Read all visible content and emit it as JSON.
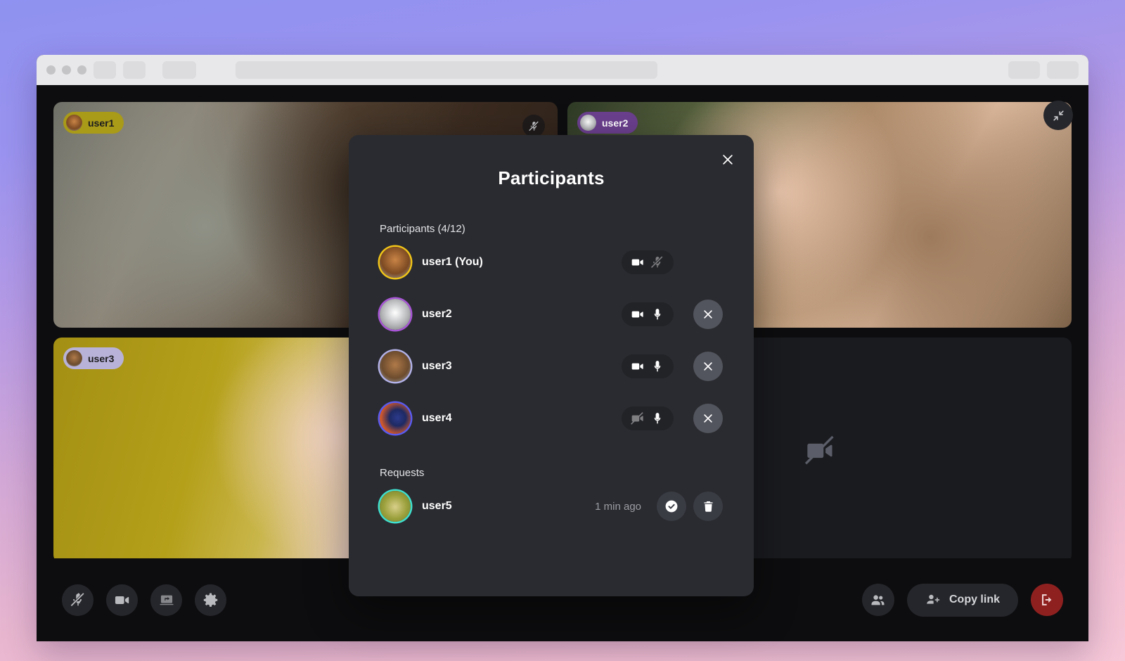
{
  "theme": {
    "page_gradient_top": "#8f92f0",
    "page_gradient_bottom": "#f3c0d3",
    "modal_bg": "#2a2b30",
    "stage_bg": "#0d0d0f",
    "leave_button_color": "#8f2020",
    "control_button_bg": "#25262b"
  },
  "browser": {
    "traffic_light_count": 3
  },
  "stage": {
    "collapse_button": "collapse-icon",
    "tiles": [
      {
        "name": "user1",
        "badge_bg": "#a99a18",
        "badge_text_color": "#1c1c1f",
        "avatar_color": "#b5733c",
        "muted": true,
        "camera_on": true
      },
      {
        "name": "user2",
        "badge_bg": "#6b3f8e",
        "badge_text_color": "#ffffff",
        "avatar_color": "#d9d9d9",
        "muted": false,
        "camera_on": true
      },
      {
        "name": "user3",
        "badge_bg": "#b8b2d8",
        "badge_text_color": "#1c1c1f",
        "avatar_color": "#8c7f72",
        "muted": false,
        "camera_on": true
      },
      {
        "name": "",
        "badge_bg": "",
        "badge_text_color": "",
        "avatar_color": "",
        "muted": false,
        "camera_on": false
      }
    ]
  },
  "controls": {
    "left": [
      {
        "label": "Microphone",
        "icon": "mic-off-icon",
        "state": "muted"
      },
      {
        "label": "Camera",
        "icon": "camera-icon",
        "state": "on"
      },
      {
        "label": "Share screen",
        "icon": "screen-share-icon",
        "state": "off"
      },
      {
        "label": "Settings",
        "icon": "gear-icon",
        "state": "off"
      }
    ],
    "right": {
      "participants_icon": "people-icon",
      "copy_link_label": "Copy link",
      "copy_link_icon": "person-add-icon",
      "leave_icon": "leave-call-icon"
    }
  },
  "modal": {
    "title": "Participants",
    "close_icon": "close-icon",
    "participants_label": "Participants (4/12)",
    "participants_count": 4,
    "participants_capacity": 12,
    "participants": [
      {
        "name": "user1 (You)",
        "avatar_ring": "#f0c419",
        "avatar_color": "#b5733c",
        "camera_on": true,
        "mic_on": false,
        "removable": false
      },
      {
        "name": "user2",
        "avatar_ring": "#a855d6",
        "avatar_color": "#d9d9d9",
        "camera_on": true,
        "mic_on": true,
        "removable": true
      },
      {
        "name": "user3",
        "avatar_ring": "#b3b2e8",
        "avatar_color": "#8c7f72",
        "camera_on": true,
        "mic_on": true,
        "removable": true
      },
      {
        "name": "user4",
        "avatar_ring": "#5b5bf0",
        "avatar_color": "#c4552a",
        "camera_on": false,
        "mic_on": true,
        "removable": true
      }
    ],
    "requests_label": "Requests",
    "requests": [
      {
        "name": "user5",
        "avatar_ring": "#3fe0cf",
        "avatar_color": "#9ba03c",
        "time": "1 min ago",
        "approve_icon": "check-circle-icon",
        "deny_icon": "trash-icon"
      }
    ]
  }
}
